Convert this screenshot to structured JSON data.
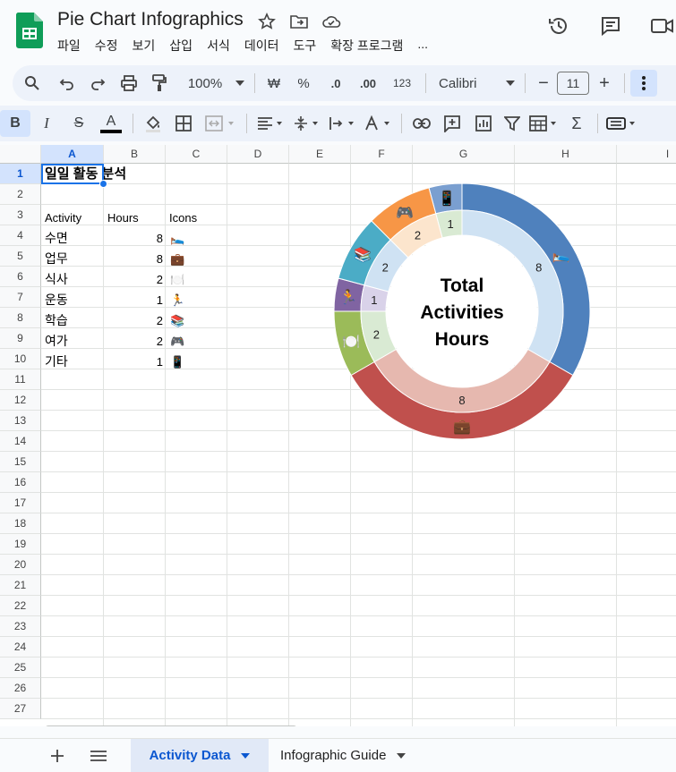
{
  "document": {
    "title": "Pie Chart Infographics"
  },
  "menu": [
    "파일",
    "수정",
    "보기",
    "삽입",
    "서식",
    "데이터",
    "도구",
    "확장 프로그램",
    "..."
  ],
  "toolbar": {
    "zoom": "100%",
    "currency": "₩",
    "percent": "%",
    "decrease_decimal": ".0",
    "increase_decimal": ".00",
    "number_format": "123",
    "font": "Calibri",
    "font_size": "11",
    "minus": "−",
    "plus": "+",
    "bold": "B",
    "italic": "I",
    "strike": "S",
    "text_color": "A",
    "sum": "Σ"
  },
  "columns": [
    "A",
    "B",
    "C",
    "D",
    "E",
    "F",
    "G",
    "H",
    "I"
  ],
  "rows": [
    "1",
    "2",
    "3",
    "4",
    "5",
    "6",
    "7",
    "8",
    "9",
    "10",
    "11",
    "12",
    "13",
    "14",
    "15",
    "16",
    "17",
    "18",
    "19",
    "20",
    "21",
    "22",
    "23",
    "24",
    "25",
    "26",
    "27"
  ],
  "sheet": {
    "title": "일일 활동 분석",
    "headers": [
      "Activity",
      "Hours",
      "Icons"
    ],
    "data": [
      {
        "activity": "수면",
        "hours": "8",
        "icon": "🛌"
      },
      {
        "activity": "업무",
        "hours": "8",
        "icon": "💼"
      },
      {
        "activity": "식사",
        "hours": "2",
        "icon": "🍽️"
      },
      {
        "activity": "운동",
        "hours": "1",
        "icon": "🏃"
      },
      {
        "activity": "학습",
        "hours": "2",
        "icon": "📚"
      },
      {
        "activity": "여가",
        "hours": "2",
        "icon": "🎮"
      },
      {
        "activity": "기타",
        "hours": "1",
        "icon": "📱"
      }
    ]
  },
  "chart_data": {
    "type": "pie",
    "title": "",
    "center_text": [
      "Total",
      "Activities",
      "Hours"
    ],
    "categories": [
      "기타",
      "수면",
      "업무",
      "식사",
      "운동",
      "학습",
      "여가"
    ],
    "values": [
      1,
      8,
      8,
      2,
      1,
      2,
      2
    ],
    "icons": [
      "📱",
      "🛌",
      "💼",
      "🍽️",
      "🏃",
      "📚",
      "🎮"
    ],
    "outer_colors": [
      "#7a9fd0",
      "#4f81bd",
      "#c0504d",
      "#9bbb59",
      "#8064a2",
      "#4bacc6",
      "#f79646"
    ],
    "inner_colors": [
      "#d9ead3",
      "#cfe2f3",
      "#e6b8af",
      "#d9ead3",
      "#d9d2e9",
      "#cfe2f3",
      "#fce5cd"
    ]
  },
  "tabs": [
    {
      "label": "Activity Data",
      "active": true
    },
    {
      "label": "Infographic Guide",
      "active": false
    }
  ]
}
